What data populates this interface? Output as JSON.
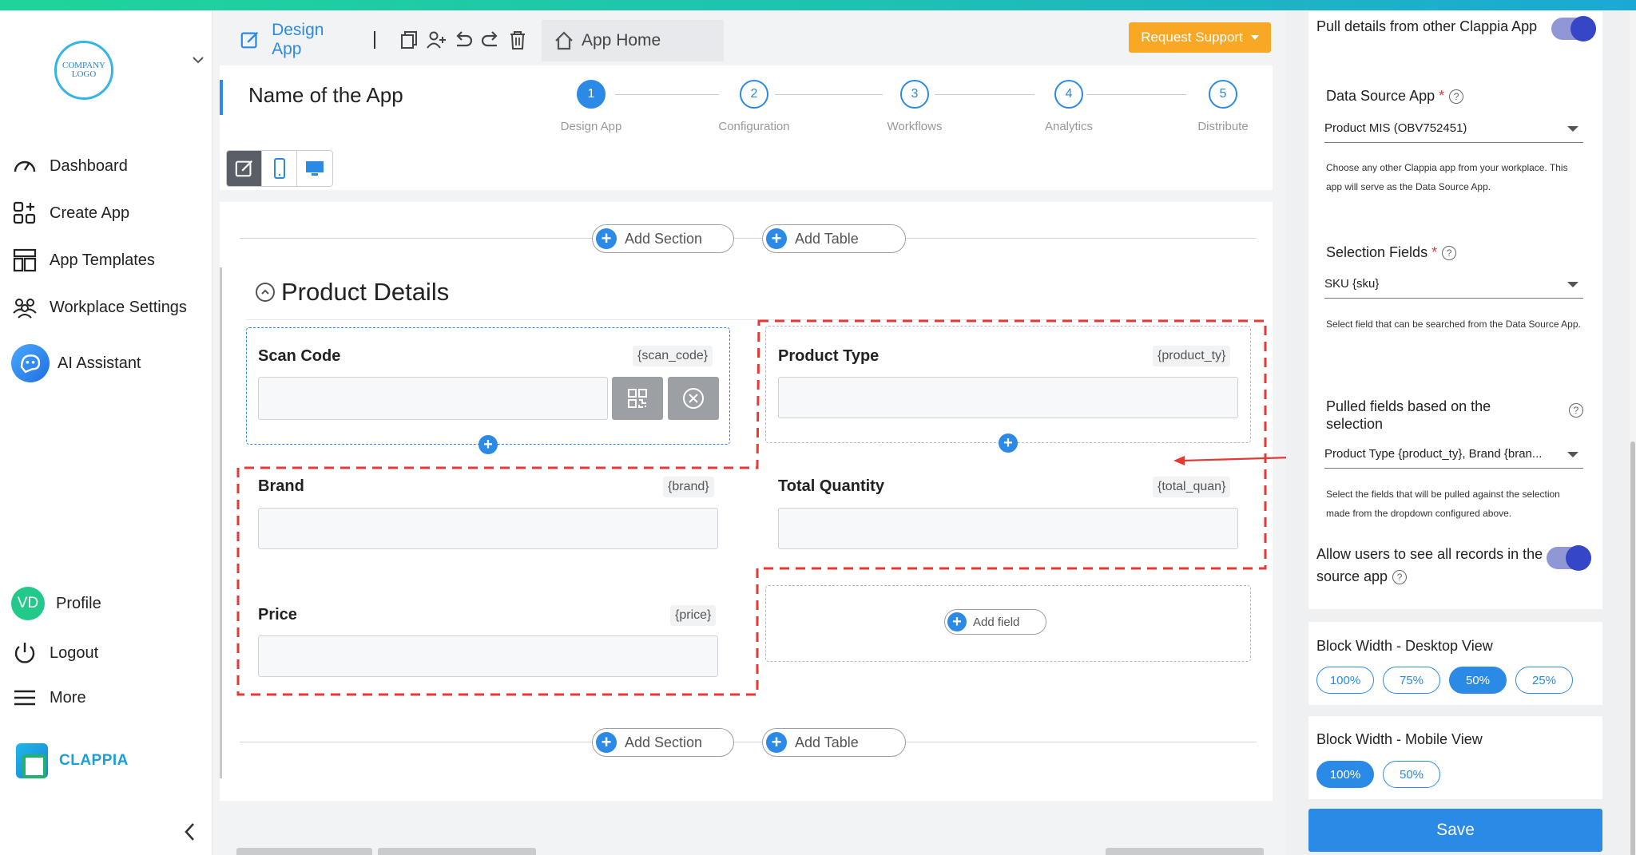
{
  "sidebar": {
    "logo_text": "COMPANY LOGO",
    "nav": [
      {
        "label": "Dashboard",
        "icon": "gauge-icon"
      },
      {
        "label": "Create App",
        "icon": "create-app-icon"
      },
      {
        "label": "App Templates",
        "icon": "templates-icon"
      },
      {
        "label": "Workplace Settings",
        "icon": "people-icon"
      },
      {
        "label": "AI Assistant",
        "icon": "ai-assistant-icon"
      }
    ],
    "profile": {
      "initials": "VD",
      "label": "Profile"
    },
    "logout_label": "Logout",
    "more_label": "More",
    "brand_name": "CLAPPIA"
  },
  "header": {
    "design_tab_label": "Design App",
    "home_tab_label": "App Home",
    "request_support_label": "Request Support"
  },
  "app": {
    "name": "Name of the App",
    "steps": [
      {
        "num": "1",
        "label": "Design App",
        "active": true
      },
      {
        "num": "2",
        "label": "Configuration",
        "active": false
      },
      {
        "num": "3",
        "label": "Workflows",
        "active": false
      },
      {
        "num": "4",
        "label": "Analytics",
        "active": false
      },
      {
        "num": "5",
        "label": "Distribute",
        "active": false
      }
    ]
  },
  "canvas": {
    "add_section_label": "Add Section",
    "add_table_label": "Add Table",
    "section_title": "Product Details",
    "add_field_label": "Add field",
    "fields": {
      "scan_code": {
        "label": "Scan Code",
        "var": "{scan_code}"
      },
      "product_type": {
        "label": "Product Type",
        "var": "{product_ty}"
      },
      "brand": {
        "label": "Brand",
        "var": "{brand}"
      },
      "total_quantity": {
        "label": "Total Quantity",
        "var": "{total_quan}"
      },
      "price": {
        "label": "Price",
        "var": "{price}"
      }
    }
  },
  "right_panel": {
    "pull_details_label": "Pull details from other Clappia App",
    "data_source_label": "Data Source App",
    "data_source_value": "Product MIS (OBV752451)",
    "data_source_help": "Choose any other Clappia app from your workplace. This app will serve as the Data Source App.",
    "selection_fields_label": "Selection Fields",
    "selection_fields_value": "SKU {sku}",
    "selection_fields_help": "Select field that can be searched from the Data Source App.",
    "pulled_fields_label": "Pulled fields based on the selection",
    "pulled_fields_value": "Product Type {product_ty}, Brand {bran...",
    "pulled_fields_help": "Select the fields that will be pulled against the selection made from the dropdown configured above.",
    "allow_users_label": "Allow users to see all records in the source app",
    "desktop_width_label": "Block Width - Desktop View",
    "desktop_options": [
      "100%",
      "75%",
      "50%",
      "25%"
    ],
    "desktop_selected": "50%",
    "mobile_width_label": "Block Width - Mobile View",
    "mobile_options": [
      "100%",
      "50%"
    ],
    "mobile_selected": "100%",
    "save_label": "Save"
  },
  "colors": {
    "accent": "#2b8ae6",
    "support": "#f9a825",
    "highlight_dash": "#e53935"
  }
}
